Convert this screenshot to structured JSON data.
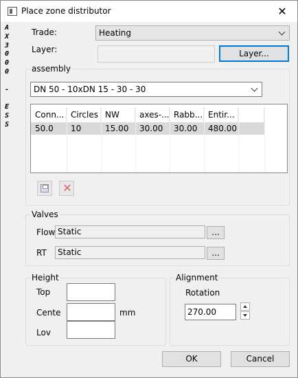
{
  "window": {
    "title": "Place zone distributor",
    "close_glyph": "✕"
  },
  "side_label": [
    "A",
    "X",
    "3",
    "0",
    "0",
    "0",
    "",
    "-",
    "",
    "E",
    "S",
    "S"
  ],
  "trade": {
    "label": "Trade:",
    "value": "Heating"
  },
  "layer": {
    "label": "Layer:",
    "value": "",
    "button": "Layer..."
  },
  "assembly": {
    "legend": "assembly",
    "selected": "DN 50 - 10xDN 15 - 30 - 30",
    "columns": [
      "Conn...",
      "Circles",
      "NW",
      "axes-...",
      "Rabb...",
      "Entir..."
    ],
    "rows": [
      [
        "50.0",
        "10",
        "15.00",
        "30.00",
        "30.00",
        "480.00"
      ]
    ]
  },
  "valves": {
    "legend": "Valves",
    "flow": {
      "label": "Flow",
      "value": "Static",
      "button": "..."
    },
    "rt": {
      "label": "RT",
      "value": "Static",
      "button": "..."
    }
  },
  "height": {
    "legend": "Height",
    "top": {
      "label": "Top",
      "value": ""
    },
    "center": {
      "label": "Cente",
      "value": ""
    },
    "low": {
      "label": "Lov",
      "value": ""
    },
    "unit": "mm"
  },
  "alignment": {
    "legend": "Alignment",
    "rotation_label": "Rotation",
    "rotation_value": "270.00"
  },
  "buttons": {
    "ok": "OK",
    "cancel": "Cancel"
  },
  "colors": {
    "accent": "#0078d7",
    "selection": "#d9d9d9",
    "delete": "#e06060"
  }
}
